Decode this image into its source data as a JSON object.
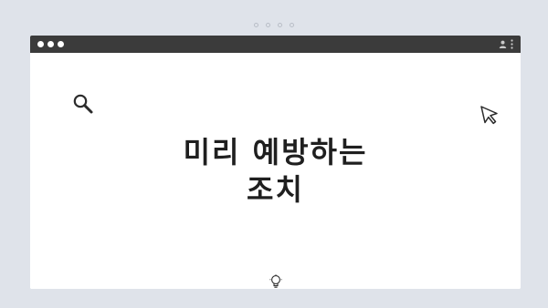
{
  "pager": {
    "dots": 4
  },
  "window": {
    "title_bar": {
      "traffic_lights": 3,
      "icons": [
        "user-icon",
        "kebab-menu-icon"
      ]
    }
  },
  "content": {
    "headline_line1": "미리 예방하는",
    "headline_line2": "조치",
    "icons": [
      "search-icon",
      "cursor-icon",
      "lightbulb-icon"
    ]
  },
  "colors": {
    "page_background": "#dfe3ea",
    "title_bar": "#3b3b3b",
    "content_background": "#ffffff",
    "headline_text": "#1f1f1f"
  }
}
